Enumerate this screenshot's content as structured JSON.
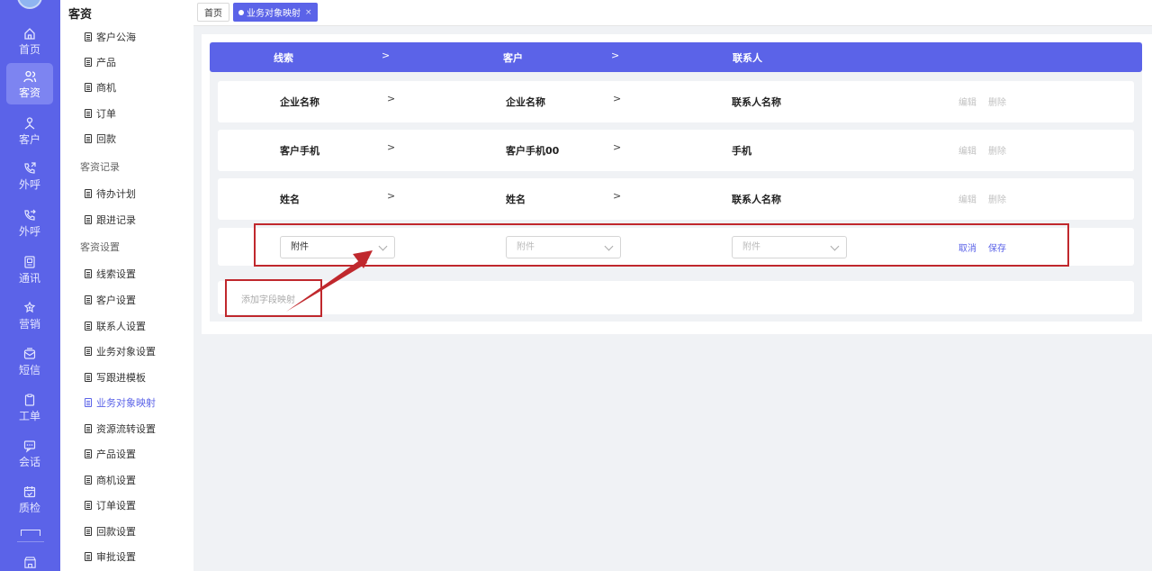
{
  "rail": {
    "items": [
      {
        "label": "首页",
        "icon": "home-icon"
      },
      {
        "label": "客资",
        "icon": "users-icon"
      },
      {
        "label": "客户",
        "icon": "user-icon"
      },
      {
        "label": "外呼",
        "icon": "phone-outgoing-icon"
      },
      {
        "label": "外呼",
        "icon": "phone-forward-icon"
      },
      {
        "label": "通讯",
        "icon": "contacts-icon"
      },
      {
        "label": "营销",
        "icon": "marketing-icon"
      },
      {
        "label": "短信",
        "icon": "sms-icon"
      },
      {
        "label": "工单",
        "icon": "clipboard-icon"
      },
      {
        "label": "会话",
        "icon": "chat-icon"
      },
      {
        "label": "质检",
        "icon": "calendar-check-icon"
      }
    ]
  },
  "sidebar": {
    "title": "客资",
    "entries": [
      {
        "kind": "item",
        "label": "客户公海"
      },
      {
        "kind": "item",
        "label": "产品"
      },
      {
        "kind": "item",
        "label": "商机"
      },
      {
        "kind": "item",
        "label": "订单"
      },
      {
        "kind": "item",
        "label": "回款"
      },
      {
        "kind": "group",
        "label": "客资记录"
      },
      {
        "kind": "item",
        "label": "待办计划"
      },
      {
        "kind": "item",
        "label": "跟进记录"
      },
      {
        "kind": "group",
        "label": "客资设置"
      },
      {
        "kind": "item",
        "label": "线索设置"
      },
      {
        "kind": "item",
        "label": "客户设置"
      },
      {
        "kind": "item",
        "label": "联系人设置"
      },
      {
        "kind": "item",
        "label": "业务对象设置"
      },
      {
        "kind": "item",
        "label": "写跟进模板"
      },
      {
        "kind": "item",
        "label": "业务对象映射",
        "active": true
      },
      {
        "kind": "item",
        "label": "资源流转设置"
      },
      {
        "kind": "item",
        "label": "产品设置"
      },
      {
        "kind": "item",
        "label": "商机设置"
      },
      {
        "kind": "item",
        "label": "订单设置"
      },
      {
        "kind": "item",
        "label": "回款设置"
      },
      {
        "kind": "item",
        "label": "审批设置"
      }
    ]
  },
  "tabs": {
    "home": "首页",
    "current": "业务对象映射",
    "close": "×"
  },
  "header": {
    "col1": "线索",
    "col2": "客户",
    "col3": "联系人",
    "arrow": ">"
  },
  "rows": [
    {
      "a": "企业名称",
      "b": "企业名称",
      "c": "联系人名称"
    },
    {
      "a": "客户手机",
      "b": "客户手机00",
      "c": "手机"
    },
    {
      "a": "姓名",
      "b": "姓名",
      "c": "联系人名称"
    }
  ],
  "actions": {
    "edit": "编辑",
    "delete": "删除",
    "cancel": "取消",
    "save": "保存"
  },
  "edit_row": {
    "a": "附件",
    "b": "附件",
    "c": "附件"
  },
  "add_label": "添加字段映射",
  "colors": {
    "brand": "#5b63e8",
    "annotation": "#c0282d"
  }
}
